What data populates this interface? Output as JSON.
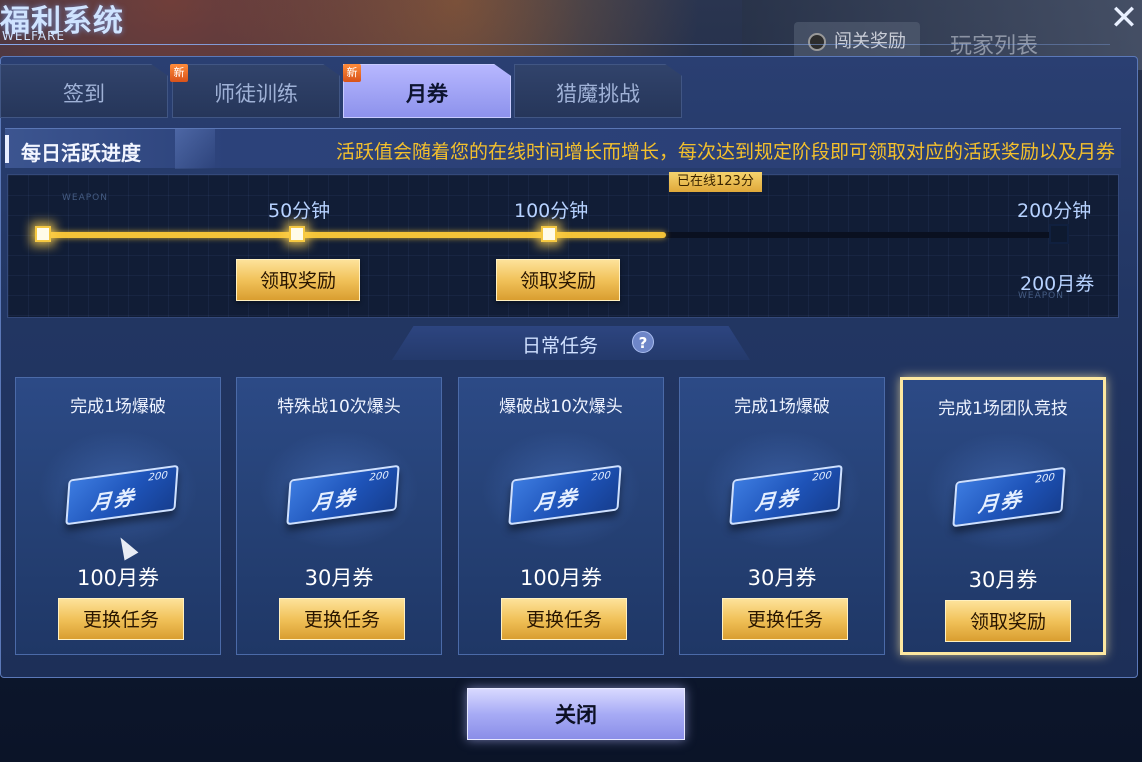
{
  "window": {
    "title_zh": "福利系统",
    "title_en": "WELFARE",
    "close_glyph": "✕"
  },
  "background": {
    "tab_achievement": "闯关奖励",
    "tab_players": "玩家列表"
  },
  "tabs": [
    {
      "label": "签到",
      "new": false,
      "active": false
    },
    {
      "label": "师徒训练",
      "new": true,
      "active": false
    },
    {
      "label": "月券",
      "new": true,
      "active": true
    },
    {
      "label": "猎魔挑战",
      "new": false,
      "active": false
    }
  ],
  "new_badge": "新",
  "progress": {
    "title": "每日活跃进度",
    "description": "活跃值会随着您的在线时间增长而增长，每次达到规定阶段即可领取对应的活跃奖励以及月券",
    "online_label": "已在线123分",
    "online_minutes": 123,
    "max_minutes": 200,
    "milestones": [
      {
        "label": "50分钟",
        "minutes": 50,
        "button": "领取奖励"
      },
      {
        "label": "100分钟",
        "minutes": 100,
        "button": "领取奖励"
      },
      {
        "label": "200分钟",
        "minutes": 200,
        "reward": "200月券"
      }
    ],
    "weapon_tag": "WEAPON"
  },
  "daily": {
    "title": "日常任务",
    "help_glyph": "?",
    "tasks": [
      {
        "title": "完成1场爆破",
        "reward": "100月券",
        "button": "更换任务",
        "highlight": false
      },
      {
        "title": "特殊战10次爆头",
        "reward": "30月券",
        "button": "更换任务",
        "highlight": false
      },
      {
        "title": "爆破战10次爆头",
        "reward": "100月券",
        "button": "更换任务",
        "highlight": false
      },
      {
        "title": "完成1场爆破",
        "reward": "30月券",
        "button": "更换任务",
        "highlight": false
      },
      {
        "title": "完成1场团队竞技",
        "reward": "30月券",
        "button": "领取奖励",
        "highlight": true
      }
    ],
    "ticket_text": "月券",
    "ticket_num": "200"
  },
  "footer": {
    "close_label": "关闭"
  },
  "colors": {
    "accent_gold": "#f4c338",
    "tab_active": "#a9acf5",
    "panel_bg": "#223663"
  }
}
